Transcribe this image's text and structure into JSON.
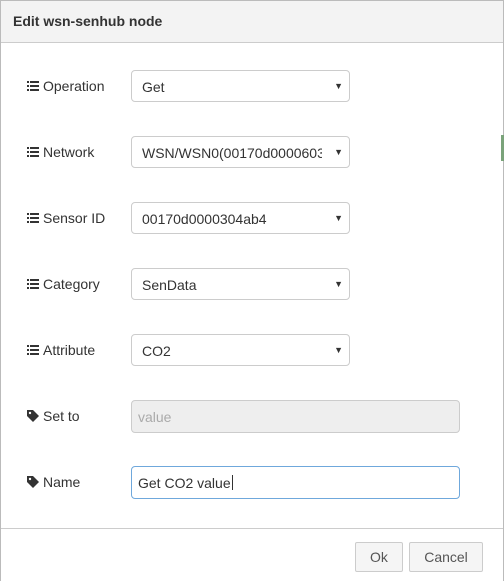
{
  "dialog": {
    "title": "Edit wsn-senhub node"
  },
  "fields": {
    "operation": {
      "label": "Operation",
      "value": "Get",
      "icon": "list-icon"
    },
    "network": {
      "label": "Network",
      "value": "WSN/WSN0(00170d0000603",
      "icon": "list-icon"
    },
    "sensor_id": {
      "label": "Sensor ID",
      "value": "00170d0000304ab4",
      "icon": "list-icon"
    },
    "category": {
      "label": "Category",
      "value": "SenData",
      "icon": "list-icon"
    },
    "attribute": {
      "label": "Attribute",
      "value": "CO2",
      "icon": "list-icon"
    },
    "set_to": {
      "label": "Set to",
      "placeholder": "value",
      "icon": "tag-icon"
    },
    "name": {
      "label": "Name",
      "value": "Get CO2 value",
      "icon": "tag-icon"
    }
  },
  "footer": {
    "ok_label": "Ok",
    "cancel_label": "Cancel"
  },
  "colors": {
    "titlebar": "#f3f3f3",
    "border": "#cccccc",
    "focus": "#6fa8dc",
    "disabled_bg": "#eeeeee"
  }
}
